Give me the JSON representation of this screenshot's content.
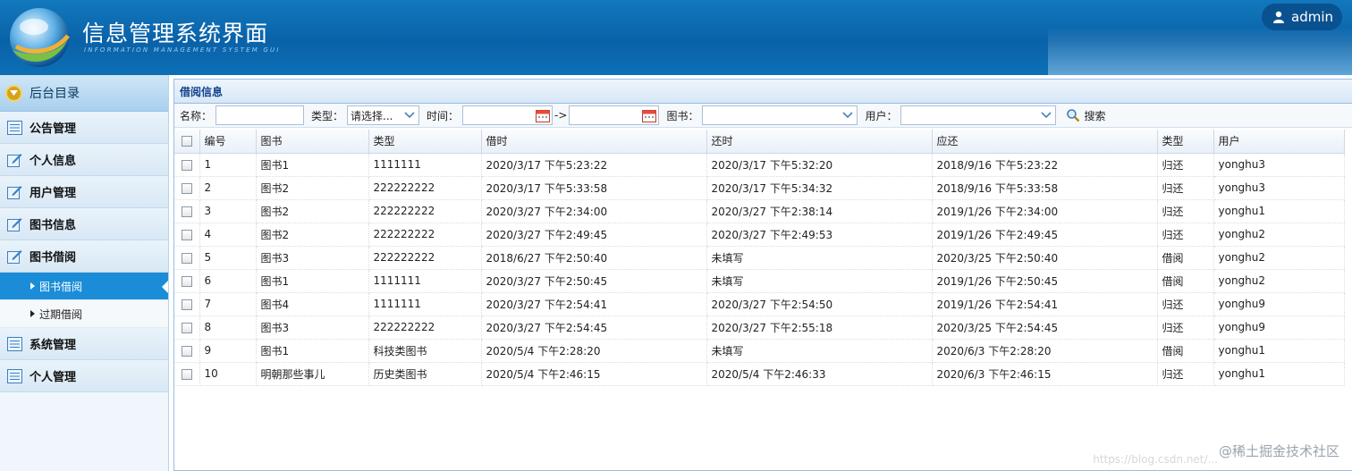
{
  "header": {
    "title": "信息管理系统界面",
    "subtitle": "INFORMATION MANAGEMENT SYSTEM GUI",
    "user": "admin",
    "colors": {
      "bg": "#0a62a8",
      "accent": "#1b8dd8"
    }
  },
  "sidebar": {
    "heading": "后台目录",
    "items": [
      {
        "label": "公告管理",
        "icon": "list-icon"
      },
      {
        "label": "个人信息",
        "icon": "edit-icon"
      },
      {
        "label": "用户管理",
        "icon": "edit-icon"
      },
      {
        "label": "图书信息",
        "icon": "edit-icon"
      },
      {
        "label": "图书借阅",
        "icon": "edit-icon"
      },
      {
        "label": "系统管理",
        "icon": "list-icon"
      },
      {
        "label": "个人管理",
        "icon": "list-icon"
      }
    ],
    "subitems": [
      {
        "label": "图书借阅",
        "active": true
      },
      {
        "label": "过期借阅",
        "active": false
      }
    ]
  },
  "panel": {
    "title": "借阅信息"
  },
  "toolbar": {
    "name_label": "名称：",
    "type_label": "类型：",
    "type_value": "请选择...",
    "time_label": "时间：",
    "time_sep": "->",
    "book_label": "图书：",
    "user_label": "用户：",
    "search_label": "搜索"
  },
  "table": {
    "columns": [
      "编号",
      "图书",
      "类型",
      "借时",
      "还时",
      "应还",
      "类型",
      "用户"
    ],
    "rows": [
      [
        "1",
        "图书1",
        "1111111",
        "2020/3/17 下午5:23:22",
        "2020/3/17 下午5:32:20",
        "2018/9/16 下午5:23:22",
        "归还",
        "yonghu3"
      ],
      [
        "2",
        "图书2",
        "222222222",
        "2020/3/17 下午5:33:58",
        "2020/3/17 下午5:34:32",
        "2018/9/16 下午5:33:58",
        "归还",
        "yonghu3"
      ],
      [
        "3",
        "图书2",
        "222222222",
        "2020/3/27 下午2:34:00",
        "2020/3/27 下午2:38:14",
        "2019/1/26 下午2:34:00",
        "归还",
        "yonghu1"
      ],
      [
        "4",
        "图书2",
        "222222222",
        "2020/3/27 下午2:49:45",
        "2020/3/27 下午2:49:53",
        "2019/1/26 下午2:49:45",
        "归还",
        "yonghu2"
      ],
      [
        "5",
        "图书3",
        "222222222",
        "2018/6/27 下午2:50:40",
        "未填写",
        "2020/3/25 下午2:50:40",
        "借阅",
        "yonghu2"
      ],
      [
        "6",
        "图书1",
        "1111111",
        "2020/3/27 下午2:50:45",
        "未填写",
        "2019/1/26 下午2:50:45",
        "借阅",
        "yonghu2"
      ],
      [
        "7",
        "图书4",
        "1111111",
        "2020/3/27 下午2:54:41",
        "2020/3/27 下午2:54:50",
        "2019/1/26 下午2:54:41",
        "归还",
        "yonghu9"
      ],
      [
        "8",
        "图书3",
        "222222222",
        "2020/3/27 下午2:54:45",
        "2020/3/27 下午2:55:18",
        "2020/3/25 下午2:54:45",
        "归还",
        "yonghu9"
      ],
      [
        "9",
        "图书1",
        "科技类图书",
        "2020/5/4 下午2:28:20",
        "未填写",
        "2020/6/3 下午2:28:20",
        "借阅",
        "yonghu1"
      ],
      [
        "10",
        "明朝那些事儿",
        "历史类图书",
        "2020/5/4 下午2:46:15",
        "2020/5/4 下午2:46:33",
        "2020/6/3 下午2:46:15",
        "归还",
        "yonghu1"
      ]
    ]
  },
  "watermark": {
    "main": "@稀土掘金技术社区",
    "faint": "https://blog.csdn.net/..."
  }
}
